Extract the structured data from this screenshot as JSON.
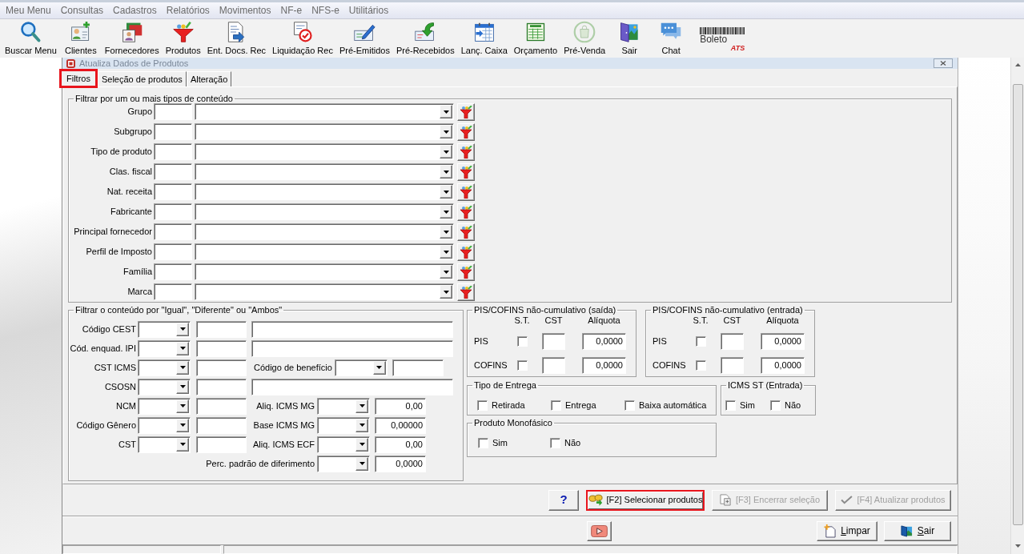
{
  "menu_bar": [
    "Meu Menu",
    "Consultas",
    "Cadastros",
    "Relatórios",
    "Movimentos",
    "NF-e",
    "NFS-e",
    "Utilitários"
  ],
  "toolbar": [
    {
      "label": "Buscar Menu",
      "kind": "search",
      "disabled": false
    },
    {
      "label": "Clientes",
      "kind": "clients",
      "disabled": false
    },
    {
      "label": "Fornecedores",
      "kind": "suppliers",
      "disabled": false
    },
    {
      "label": "Produtos",
      "kind": "products",
      "disabled": false
    },
    {
      "label": "Ent. Docs. Rec",
      "kind": "documents",
      "disabled": false
    },
    {
      "label": "Liquidação Rec",
      "kind": "settlement",
      "disabled": false
    },
    {
      "label": "Pré-Emitidos",
      "kind": "issued",
      "disabled": false
    },
    {
      "label": "Pré-Recebidos",
      "kind": "received",
      "disabled": false
    },
    {
      "label": "Lanç. Caixa",
      "kind": "cashbook",
      "disabled": false
    },
    {
      "label": "Orçamento",
      "kind": "budget",
      "disabled": false
    },
    {
      "label": "Pré-Venda",
      "kind": "presale",
      "disabled": true
    },
    {
      "label": "Sair",
      "kind": "exit",
      "disabled": false
    },
    {
      "label": "Chat",
      "kind": "chat",
      "disabled": false
    },
    {
      "label": "Boleto",
      "mark": "ATS",
      "kind": "logo",
      "disabled": false
    }
  ],
  "window": {
    "title": "Atualiza Dados de Produtos"
  },
  "tabs": [
    {
      "label": "Filtros",
      "selected": true,
      "highlighted": true
    },
    {
      "label": "Seleção de produtos",
      "selected": false,
      "highlighted": false
    },
    {
      "label": "Alteração",
      "selected": false,
      "highlighted": false
    }
  ],
  "content_filters": {
    "title": "Filtrar por um ou mais tipos de conteúdo",
    "rows": [
      "Grupo",
      "Subgrupo",
      "Tipo de produto",
      "Clas. fiscal",
      "Nat. receita",
      "Fabricante",
      "Principal fornecedor",
      "Perfil de Imposto",
      "Família",
      "Marca"
    ]
  },
  "compare_filters": {
    "title": "Filtrar o conteúdo por \"Igual\", \"Diferente\" ou \"Ambos\"",
    "rows": [
      {
        "label": "Código CEST",
        "kind": "wide"
      },
      {
        "label": "Cód. enquad. IPI",
        "kind": "wide"
      },
      {
        "label": "CST ICMS",
        "kind": "code",
        "extra_label": "Código de benefício"
      },
      {
        "label": "CSOSN",
        "kind": "wide"
      },
      {
        "label": "NCM",
        "kind": "value",
        "extra_label": "Aliq. ICMS MG",
        "extra_value": "0,00"
      },
      {
        "label": "Código Gênero",
        "kind": "value",
        "extra_label": "Base ICMS MG",
        "extra_value": "0,00000"
      },
      {
        "label": "CST",
        "kind": "value",
        "extra_label": "Aliq. ICMS ECF",
        "extra_value": "0,00"
      },
      {
        "kind": "value",
        "extra_label": "Perc. padrão de diferimento",
        "extra_value": "0,0000"
      }
    ]
  },
  "pis_cofins": [
    {
      "title": "PIS/COFINS não-cumulativo (saída)",
      "columns": [
        "S.T.",
        "CST",
        "Alíquota"
      ],
      "rows": [
        {
          "label": "PIS",
          "st": false,
          "rate": "0,0000"
        },
        {
          "label": "COFINS",
          "st": false,
          "rate": "0,0000"
        }
      ]
    },
    {
      "title": "PIS/COFINS não-cumulativo (entrada)",
      "columns": [
        "S.T.",
        "CST",
        "Alíquota"
      ],
      "rows": [
        {
          "label": "PIS",
          "st": false,
          "rate": "0,0000"
        },
        {
          "label": "COFINS",
          "st": false,
          "rate": "0,0000"
        }
      ]
    }
  ],
  "delivery_type": {
    "title": "Tipo de Entrega",
    "options": [
      {
        "label": "Retirada",
        "checked": false
      },
      {
        "label": "Entrega",
        "checked": false
      },
      {
        "label": "Baixa automática",
        "checked": false
      }
    ]
  },
  "icms_st_entry": {
    "title": "ICMS ST (Entrada)",
    "options": [
      {
        "label": "Sim",
        "checked": false
      },
      {
        "label": "Não",
        "checked": false
      }
    ]
  },
  "monophasic": {
    "title": "Produto Monofásico",
    "options": [
      {
        "label": "Sim",
        "checked": false
      },
      {
        "label": "Não",
        "checked": false
      }
    ]
  },
  "action_buttons": [
    {
      "label": "?",
      "kind": "help",
      "disabled": false,
      "highlighted": false
    },
    {
      "label": "[F2] Selecionar produtos",
      "kind": "select",
      "disabled": false,
      "highlighted": true
    },
    {
      "label": "[F3] Encerrar seleção",
      "kind": "finish",
      "disabled": true,
      "highlighted": false
    },
    {
      "label": "[F4] Atualizar produtos",
      "kind": "update",
      "disabled": true,
      "highlighted": false
    }
  ],
  "footer_buttons": [
    {
      "kind": "video"
    },
    {
      "label": "Limpar",
      "kind": "clear",
      "mnemonic": true
    },
    {
      "label": "Sair",
      "kind": "exit",
      "mnemonic": true
    }
  ]
}
